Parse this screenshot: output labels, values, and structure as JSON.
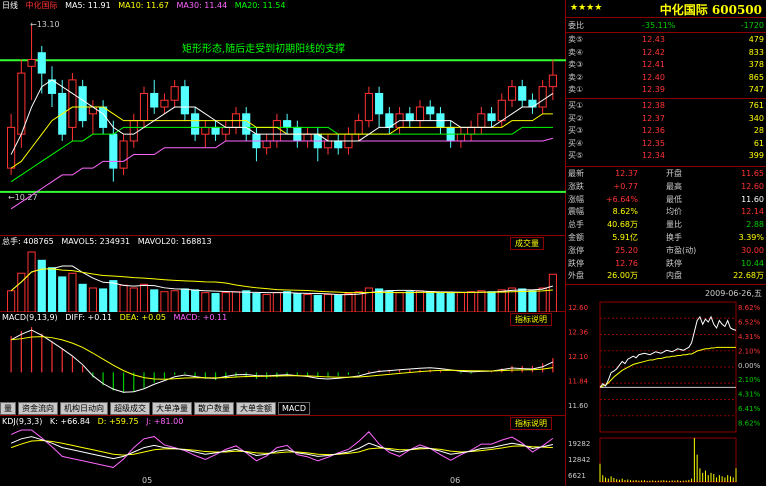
{
  "window": {
    "title_left": "日线",
    "stock_name_small": "中化国际"
  },
  "main_chart": {
    "ma_labels": [
      "MA5: 11.91",
      "MA10: 11.67",
      "MA30: 11.44",
      "MA20: 11.54"
    ],
    "ma_colors": [
      "#ffffff",
      "#ffff00",
      "#ff66ff",
      "#00ff00"
    ],
    "annotation": "矩形形态,随后走受到初期阳线的支撑",
    "high_marker": "13.10",
    "low_marker": "10.27",
    "price_range": [
      10.0,
      13.3
    ],
    "top_line": 12.59,
    "bottom_line": 10.65,
    "candles": [
      [
        11.0,
        11.6,
        10.9,
        11.8
      ],
      [
        11.5,
        12.4,
        11.3,
        12.6
      ],
      [
        12.5,
        12.6,
        12.0,
        13.1
      ],
      [
        12.7,
        12.4,
        12.1,
        12.8
      ],
      [
        12.3,
        12.1,
        11.9,
        12.5
      ],
      [
        12.1,
        11.5,
        11.4,
        12.3
      ],
      [
        11.6,
        12.3,
        11.4,
        12.4
      ],
      [
        12.2,
        11.7,
        11.6,
        12.3
      ],
      [
        11.8,
        11.9,
        11.5,
        12.0
      ],
      [
        11.9,
        11.6,
        11.5,
        12.0
      ],
      [
        11.5,
        11.0,
        10.8,
        11.7
      ],
      [
        11.0,
        11.4,
        10.9,
        11.5
      ],
      [
        11.4,
        11.7,
        11.3,
        11.8
      ],
      [
        11.7,
        12.1,
        11.6,
        12.2
      ],
      [
        12.1,
        11.9,
        11.8,
        12.3
      ],
      [
        11.9,
        12.0,
        11.8,
        12.1
      ],
      [
        12.0,
        12.2,
        11.9,
        12.3
      ],
      [
        12.2,
        11.8,
        11.7,
        12.3
      ],
      [
        11.8,
        11.5,
        11.4,
        11.9
      ],
      [
        11.5,
        11.6,
        11.3,
        11.7
      ],
      [
        11.6,
        11.5,
        11.4,
        11.7
      ],
      [
        11.5,
        11.6,
        11.4,
        11.7
      ],
      [
        11.6,
        11.8,
        11.5,
        11.9
      ],
      [
        11.8,
        11.5,
        11.4,
        11.9
      ],
      [
        11.5,
        11.3,
        11.1,
        11.6
      ],
      [
        11.3,
        11.4,
        11.2,
        11.5
      ],
      [
        11.4,
        11.7,
        11.3,
        11.8
      ],
      [
        11.7,
        11.6,
        11.5,
        11.8
      ],
      [
        11.6,
        11.4,
        11.3,
        11.7
      ],
      [
        11.4,
        11.5,
        11.3,
        11.6
      ],
      [
        11.5,
        11.3,
        11.1,
        11.6
      ],
      [
        11.3,
        11.4,
        11.2,
        11.5
      ],
      [
        11.4,
        11.3,
        11.2,
        11.5
      ],
      [
        11.3,
        11.5,
        11.2,
        11.6
      ],
      [
        11.5,
        11.7,
        11.4,
        11.8
      ],
      [
        11.7,
        12.1,
        11.6,
        12.2
      ],
      [
        12.1,
        11.8,
        11.6,
        12.2
      ],
      [
        11.8,
        11.6,
        11.5,
        11.9
      ],
      [
        11.6,
        11.8,
        11.5,
        11.9
      ],
      [
        11.8,
        11.7,
        11.6,
        11.9
      ],
      [
        11.7,
        11.9,
        11.6,
        12.0
      ],
      [
        11.9,
        11.8,
        11.7,
        12.0
      ],
      [
        11.8,
        11.6,
        11.5,
        11.9
      ],
      [
        11.6,
        11.4,
        11.3,
        11.7
      ],
      [
        11.4,
        11.5,
        11.3,
        11.6
      ],
      [
        11.5,
        11.6,
        11.4,
        11.7
      ],
      [
        11.6,
        11.8,
        11.5,
        11.9
      ],
      [
        11.8,
        11.7,
        11.6,
        11.9
      ],
      [
        11.7,
        12.0,
        11.6,
        12.1
      ],
      [
        12.0,
        12.2,
        11.9,
        12.3
      ],
      [
        12.2,
        12.0,
        11.9,
        12.3
      ],
      [
        12.0,
        11.9,
        11.8,
        12.1
      ],
      [
        11.9,
        12.2,
        11.8,
        12.3
      ],
      [
        12.2,
        12.37,
        12.0,
        12.6
      ]
    ],
    "ma5": [
      11.2,
      11.5,
      11.9,
      12.2,
      12.3,
      12.2,
      12.1,
      12.0,
      11.9,
      11.8,
      11.6,
      11.5,
      11.5,
      11.6,
      11.7,
      11.8,
      11.9,
      11.9,
      11.9,
      11.8,
      11.7,
      11.6,
      11.6,
      11.6,
      11.5,
      11.5,
      11.5,
      11.5,
      11.5,
      11.5,
      11.5,
      11.4,
      11.4,
      11.4,
      11.4,
      11.5,
      11.6,
      11.6,
      11.7,
      11.7,
      11.7,
      11.7,
      11.7,
      11.7,
      11.6,
      11.6,
      11.6,
      11.6,
      11.7,
      11.8,
      11.9,
      11.9,
      12.0,
      12.1
    ],
    "ma10": [
      11.0,
      11.1,
      11.3,
      11.5,
      11.7,
      11.8,
      11.9,
      11.9,
      11.9,
      11.9,
      11.8,
      11.7,
      11.7,
      11.7,
      11.7,
      11.7,
      11.7,
      11.7,
      11.7,
      11.7,
      11.7,
      11.7,
      11.7,
      11.7,
      11.6,
      11.6,
      11.6,
      11.5,
      11.5,
      11.5,
      11.5,
      11.5,
      11.5,
      11.5,
      11.5,
      11.5,
      11.5,
      11.5,
      11.6,
      11.6,
      11.6,
      11.6,
      11.6,
      11.6,
      11.6,
      11.6,
      11.6,
      11.6,
      11.6,
      11.7,
      11.7,
      11.7,
      11.8,
      11.8
    ],
    "ma20": [
      10.8,
      10.9,
      11.0,
      11.1,
      11.2,
      11.3,
      11.4,
      11.4,
      11.5,
      11.5,
      11.5,
      11.6,
      11.6,
      11.6,
      11.6,
      11.6,
      11.6,
      11.6,
      11.6,
      11.6,
      11.6,
      11.6,
      11.6,
      11.6,
      11.6,
      11.6,
      11.6,
      11.6,
      11.6,
      11.6,
      11.6,
      11.6,
      11.5,
      11.5,
      11.5,
      11.5,
      11.5,
      11.5,
      11.5,
      11.5,
      11.5,
      11.5,
      11.5,
      11.5,
      11.5,
      11.5,
      11.5,
      11.5,
      11.5,
      11.5,
      11.6,
      11.6,
      11.6,
      11.6
    ],
    "ma30": [
      10.4,
      10.5,
      10.6,
      10.7,
      10.8,
      10.9,
      10.9,
      11.0,
      11.0,
      11.1,
      11.1,
      11.1,
      11.2,
      11.2,
      11.2,
      11.3,
      11.3,
      11.3,
      11.3,
      11.3,
      11.3,
      11.4,
      11.4,
      11.4,
      11.4,
      11.4,
      11.4,
      11.4,
      11.4,
      11.4,
      11.4,
      11.4,
      11.4,
      11.4,
      11.4,
      11.4,
      11.4,
      11.4,
      11.4,
      11.4,
      11.4,
      11.4,
      11.4,
      11.4,
      11.4,
      11.4,
      11.4,
      11.4,
      11.4,
      11.4,
      11.4,
      11.4,
      11.4,
      11.44
    ]
  },
  "volume": {
    "labels": [
      "总手: 408765",
      "MAVOL5: 234931",
      "MAVOL20: 168813"
    ],
    "button": "成交量",
    "values": [
      230,
      420,
      650,
      560,
      480,
      380,
      420,
      300,
      260,
      250,
      340,
      290,
      260,
      300,
      240,
      220,
      230,
      250,
      240,
      210,
      200,
      210,
      220,
      230,
      200,
      190,
      210,
      220,
      200,
      190,
      180,
      190,
      180,
      200,
      220,
      260,
      250,
      230,
      210,
      220,
      230,
      220,
      210,
      200,
      210,
      220,
      230,
      220,
      240,
      260,
      250,
      230,
      260,
      409
    ]
  },
  "macd": {
    "labels": [
      "MACD(9,13,9)",
      "DIFF: +0.11",
      "DEA: +0.05",
      "MACD: +0.11"
    ],
    "button": "指标说明",
    "hist": [
      0.28,
      0.32,
      0.35,
      0.3,
      0.24,
      0.18,
      0.12,
      0.05,
      -0.04,
      -0.1,
      -0.14,
      -0.16,
      -0.15,
      -0.12,
      -0.08,
      -0.05,
      -0.02,
      -0.01,
      -0.03,
      -0.05,
      -0.06,
      -0.05,
      -0.04,
      -0.04,
      -0.05,
      -0.05,
      -0.04,
      -0.03,
      -0.03,
      -0.03,
      -0.04,
      -0.04,
      -0.03,
      -0.02,
      -0.01,
      0.01,
      0.02,
      0.02,
      0.02,
      0.02,
      0.02,
      0.02,
      0.01,
      0.0,
      -0.01,
      -0.01,
      0.0,
      0.01,
      0.03,
      0.05,
      0.05,
      0.05,
      0.07,
      0.11
    ]
  },
  "tabs": [
    "量",
    "资金流向",
    "机构日动向",
    "超级成交",
    "大单净量",
    "散户数量",
    "大单金额",
    "MACD"
  ],
  "kdj": {
    "labels": [
      "KDJ(9,3,3)",
      "K: +66.84",
      "D: +59.75",
      "J: +81.00"
    ],
    "button": "指标说明",
    "k": [
      70,
      80,
      85,
      78,
      70,
      60,
      55,
      50,
      45,
      40,
      35,
      40,
      50,
      60,
      65,
      60,
      58,
      55,
      50,
      45,
      48,
      52,
      56,
      50,
      42,
      45,
      52,
      55,
      48,
      45,
      40,
      42,
      46,
      50,
      58,
      70,
      62,
      55,
      50,
      55,
      60,
      58,
      52,
      45,
      48,
      52,
      58,
      60,
      65,
      70,
      66,
      58,
      62,
      67
    ],
    "d": [
      60,
      68,
      75,
      76,
      74,
      70,
      65,
      60,
      55,
      50,
      45,
      43,
      45,
      50,
      55,
      57,
      57,
      56,
      54,
      51,
      50,
      50,
      52,
      51,
      48,
      47,
      48,
      50,
      50,
      48,
      45,
      44,
      45,
      47,
      50,
      57,
      59,
      58,
      55,
      55,
      57,
      58,
      56,
      52,
      50,
      51,
      53,
      56,
      59,
      63,
      64,
      62,
      61,
      60
    ],
    "j": [
      90,
      100,
      100,
      82,
      62,
      40,
      35,
      30,
      25,
      20,
      15,
      34,
      60,
      80,
      85,
      66,
      60,
      53,
      42,
      33,
      44,
      56,
      64,
      48,
      30,
      41,
      60,
      65,
      44,
      39,
      30,
      38,
      48,
      56,
      74,
      96,
      68,
      49,
      40,
      55,
      66,
      58,
      44,
      31,
      44,
      54,
      68,
      68,
      77,
      84,
      70,
      50,
      64,
      81
    ]
  },
  "x_axis": {
    "ticks": [
      "05",
      "06"
    ]
  },
  "quote": {
    "stars": "★★★★",
    "title": "中化国际 600500",
    "weibi": {
      "k": "委比",
      "v1": "-35.11%",
      "v3": "-1720"
    },
    "asks": [
      {
        "k": "卖⑤",
        "p": "12.43",
        "v": "479"
      },
      {
        "k": "卖④",
        "p": "12.42",
        "v": "833"
      },
      {
        "k": "卖③",
        "p": "12.41",
        "v": "378"
      },
      {
        "k": "卖②",
        "p": "12.40",
        "v": "865"
      },
      {
        "k": "卖①",
        "p": "12.39",
        "v": "747"
      }
    ],
    "bids": [
      {
        "k": "买①",
        "p": "12.38",
        "v": "761"
      },
      {
        "k": "买②",
        "p": "12.37",
        "v": "340"
      },
      {
        "k": "买③",
        "p": "12.36",
        "v": "28"
      },
      {
        "k": "买④",
        "p": "12.35",
        "v": "61"
      },
      {
        "k": "买⑤",
        "p": "12.34",
        "v": "399"
      }
    ],
    "stats": [
      {
        "k": "最新",
        "v": "12.37",
        "k2": "开盘",
        "v2": "11.65"
      },
      {
        "k": "涨跌",
        "v": "+0.77",
        "k2": "最高",
        "v2": "12.60"
      },
      {
        "k": "涨幅",
        "v": "+6.64%",
        "k2": "最低",
        "v2": "11.60"
      },
      {
        "k": "震幅",
        "v": "8.62%",
        "k2": "均价",
        "v2": "12.14"
      },
      {
        "k": "总手",
        "v": "40.68万",
        "k2": "量比",
        "v2": "2.88"
      },
      {
        "k": "金额",
        "v": "5.91亿",
        "k2": "换手",
        "v2": "3.39%"
      },
      {
        "k": "涨停",
        "v": "25.20",
        "k2": "市盈(动)",
        "v2": "30.00"
      },
      {
        "k": "跌停",
        "v": "12.76",
        "k2": "跌停",
        "v2": "10.44"
      },
      {
        "k": "外盘",
        "v": "26.00万",
        "k2": "内盘",
        "v2": "22.68万"
      }
    ],
    "colors": {
      "up": "#ff3333",
      "down": "#00cc00",
      "flat": "#ffffff",
      "label": "#cccccc",
      "accent": "#ffff00"
    }
  },
  "intraday": {
    "date": "2009-06-26,五",
    "left_prices": [
      "12.60",
      "12.36",
      "12.10",
      "11.84",
      "11.60"
    ],
    "right_pcts": [
      "8.62%",
      "6.52%",
      "4.31%",
      "2.10%",
      "0.00%",
      "2.10%",
      "4.31%",
      "6.41%",
      "8.62%"
    ],
    "vol_ticks": [
      "19282",
      "12842",
      "6621"
    ],
    "price_range": [
      11.0,
      12.75
    ],
    "price": [
      11.6,
      11.65,
      11.62,
      11.7,
      11.8,
      11.82,
      11.85,
      11.9,
      11.95,
      11.92,
      11.98,
      12.0,
      12.02,
      12.0,
      12.04,
      12.05,
      12.06,
      12.05,
      12.04,
      12.06,
      12.08,
      12.07,
      12.06,
      12.08,
      12.1,
      12.09,
      12.08,
      12.1,
      12.12,
      12.11,
      12.1,
      12.12,
      12.14,
      12.2,
      12.35,
      12.5,
      12.55,
      12.45,
      12.52,
      12.48,
      12.55,
      12.45,
      12.4,
      12.5,
      12.45,
      12.42,
      12.5,
      12.4,
      12.38,
      12.37
    ],
    "avg": [
      11.6,
      11.62,
      11.63,
      11.66,
      11.7,
      11.74,
      11.77,
      11.8,
      11.83,
      11.85,
      11.87,
      11.89,
      11.91,
      11.92,
      11.93,
      11.94,
      11.95,
      11.96,
      11.97,
      11.97,
      11.98,
      11.99,
      11.99,
      12.0,
      12.01,
      12.01,
      12.02,
      12.02,
      12.03,
      12.03,
      12.04,
      12.04,
      12.05,
      12.05,
      12.07,
      12.09,
      12.1,
      12.11,
      12.12,
      12.12,
      12.13,
      12.13,
      12.14,
      12.14,
      12.14,
      12.14,
      12.14,
      12.14,
      12.14,
      12.14
    ],
    "vol": [
      8000,
      3000,
      2000,
      1500,
      2500,
      1800,
      1200,
      1000,
      1500,
      900,
      1100,
      800,
      700,
      900,
      600,
      700,
      800,
      500,
      600,
      700,
      500,
      600,
      700,
      800,
      600,
      500,
      700,
      600,
      800,
      500,
      600,
      700,
      900,
      1500,
      19282,
      12000,
      6000,
      4000,
      5000,
      3000,
      4000,
      3500,
      2000,
      3000,
      2500,
      2000,
      3000,
      2500,
      2000,
      6000
    ]
  }
}
